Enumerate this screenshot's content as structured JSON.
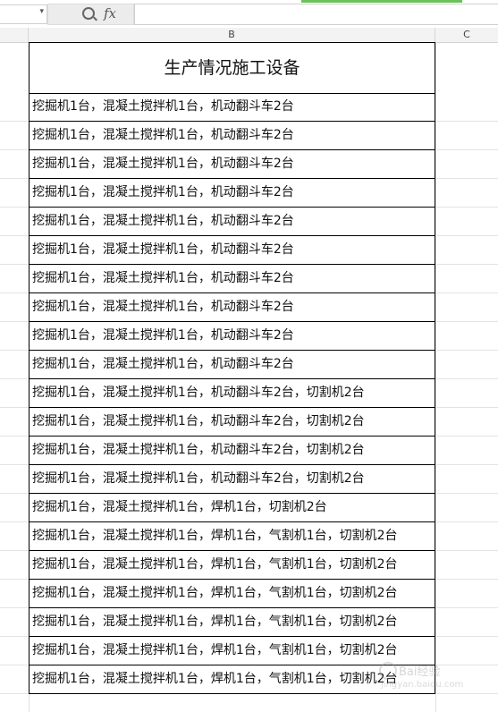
{
  "toolbar": {
    "namebox_value": "",
    "fx_label": "fx",
    "formula_value": ""
  },
  "columns": [
    "B",
    "C"
  ],
  "sheet": {
    "title": "生产情况施工设备",
    "rows": [
      "挖掘机1台，混凝土搅拌机1台，机动翻斗车2台",
      "挖掘机1台，混凝土搅拌机1台，机动翻斗车2台",
      "挖掘机1台，混凝土搅拌机1台，机动翻斗车2台",
      "挖掘机1台，混凝土搅拌机1台，机动翻斗车2台",
      "挖掘机1台，混凝土搅拌机1台，机动翻斗车2台",
      "挖掘机1台，混凝土搅拌机1台，机动翻斗车2台",
      "挖掘机1台，混凝土搅拌机1台，机动翻斗车2台",
      "挖掘机1台，混凝土搅拌机1台，机动翻斗车2台",
      "挖掘机1台，混凝土搅拌机1台，机动翻斗车2台",
      "挖掘机1台，混凝土搅拌机1台，机动翻斗车2台",
      "挖掘机1台，混凝土搅拌机1台，机动翻斗车2台，切割机2台",
      "挖掘机1台，混凝土搅拌机1台，机动翻斗车2台，切割机2台",
      "挖掘机1台，混凝土搅拌机1台，机动翻斗车2台，切割机2台",
      "挖掘机1台，混凝土搅拌机1台，机动翻斗车2台，切割机2台",
      "挖掘机1台，混凝土搅拌机1台，焊机1台，切割机2台",
      "挖掘机1台，混凝土搅拌机1台，焊机1台，气割机1台，切割机2台",
      "挖掘机1台，混凝土搅拌机1台，焊机1台，气割机1台，切割机2台",
      "挖掘机1台，混凝土搅拌机1台，焊机1台，气割机1台，切割机2台",
      "挖掘机1台，混凝土搅拌机1台，焊机1台，气割机1台，切割机2台",
      "挖掘机1台，混凝土搅拌机1台，焊机1台，气割机1台，切割机2台",
      "挖掘机1台，混凝土搅拌机1台，焊机1台，气割机1台，切割机2台"
    ]
  },
  "watermark": {
    "text": "Bai经验",
    "url": "jingyan.baidu.com"
  },
  "colors": {
    "accent_strip": "#6bc15a",
    "header_bg": "#f3f3f3",
    "grid": "#e0e0e0"
  }
}
